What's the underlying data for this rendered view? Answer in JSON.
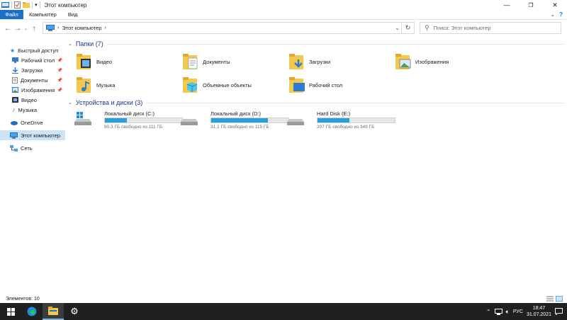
{
  "window": {
    "title": "Этот компьютер"
  },
  "ribbon": {
    "tabs": [
      "Файл",
      "Компьютер",
      "Вид"
    ]
  },
  "address": {
    "path": "Этот компьютер"
  },
  "search": {
    "placeholder": "Поиск: Этот компьютер"
  },
  "sidebar": {
    "items": [
      {
        "label": "Быстрый доступ",
        "icon": "star-icon"
      },
      {
        "label": "Рабочий стол",
        "icon": "desktop-icon",
        "pinned": true
      },
      {
        "label": "Загрузки",
        "icon": "download-icon",
        "pinned": true
      },
      {
        "label": "Документы",
        "icon": "documents-icon",
        "pinned": true
      },
      {
        "label": "Изображения",
        "icon": "pictures-icon",
        "pinned": true
      },
      {
        "label": "Видео",
        "icon": "video-icon"
      },
      {
        "label": "Музыка",
        "icon": "music-icon"
      },
      {
        "label": "OneDrive",
        "icon": "onedrive-icon"
      },
      {
        "label": "Этот компьютер",
        "icon": "computer-icon",
        "selected": true
      },
      {
        "label": "Сеть",
        "icon": "network-icon"
      }
    ]
  },
  "folders": {
    "header": "Папки (7)",
    "items": [
      {
        "label": "Видео",
        "icon": "video-folder-icon"
      },
      {
        "label": "Документы",
        "icon": "documents-folder-icon"
      },
      {
        "label": "Загрузки",
        "icon": "downloads-folder-icon"
      },
      {
        "label": "Изображения",
        "icon": "pictures-folder-icon"
      },
      {
        "label": "Музыка",
        "icon": "music-folder-icon"
      },
      {
        "label": "Объемные объекты",
        "icon": "3d-objects-folder-icon"
      },
      {
        "label": "Рабочий стол",
        "icon": "desktop-folder-icon"
      }
    ]
  },
  "drives": {
    "header": "Устройства и диски (3)",
    "items": [
      {
        "label": "Локальный диск (C:)",
        "free": "80,3 ГБ свободно из 111 ГБ",
        "used_fraction": 0.28,
        "icon": "windows-drive-icon"
      },
      {
        "label": "Локальный диск (D:)",
        "free": "31,1 ГБ свободно из 115 ГБ",
        "used_fraction": 0.73,
        "icon": "drive-icon"
      },
      {
        "label": "Hard Disk (E:)",
        "free": "207 ГБ свободно из 349 ГБ",
        "used_fraction": 0.41,
        "icon": "drive-icon"
      }
    ]
  },
  "status": {
    "items": "Элементов: 10"
  },
  "taskbar": {
    "lang": "РУС",
    "time": "18:47",
    "date": "31.07.2021"
  },
  "colors": {
    "accent": "#1a6fc9",
    "bar": "#26a0da",
    "selected": "#cce4f7",
    "taskbar": "#1f2022"
  }
}
